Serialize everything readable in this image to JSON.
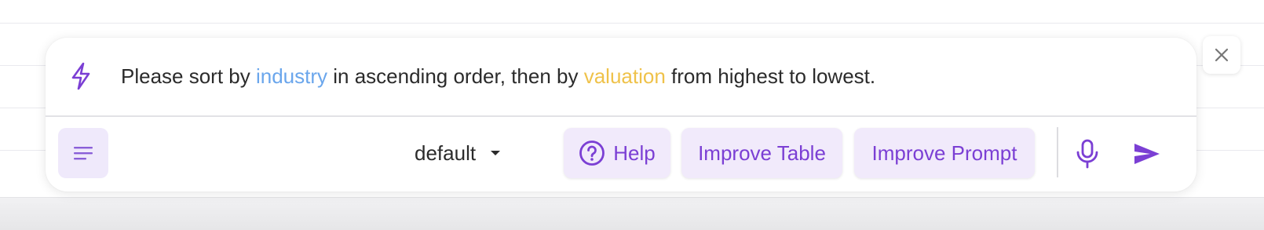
{
  "prompt": {
    "segments": [
      {
        "text": "Please sort by ",
        "style": "plain"
      },
      {
        "text": "industry",
        "style": "blue"
      },
      {
        "text": " in ascending order, then by ",
        "style": "plain"
      },
      {
        "text": "valuation",
        "style": "yellow"
      },
      {
        "text": " from highest to lowest.",
        "style": "plain"
      }
    ],
    "icon": "lightning-bolt-icon"
  },
  "toolbar": {
    "menu_icon": "menu-lines-icon",
    "mode_value": "default",
    "help_label": "Help",
    "improve_table_label": "Improve Table",
    "improve_prompt_label": "Improve Prompt",
    "mic_icon": "microphone-icon",
    "send_icon": "send-icon"
  },
  "close_icon": "close-icon",
  "colors": {
    "accent": "#7b3fd4",
    "chip_bg": "#f1eafb",
    "keyword_blue": "#6aa6ec",
    "keyword_yellow": "#efc24a",
    "text": "#2b2b2b"
  }
}
